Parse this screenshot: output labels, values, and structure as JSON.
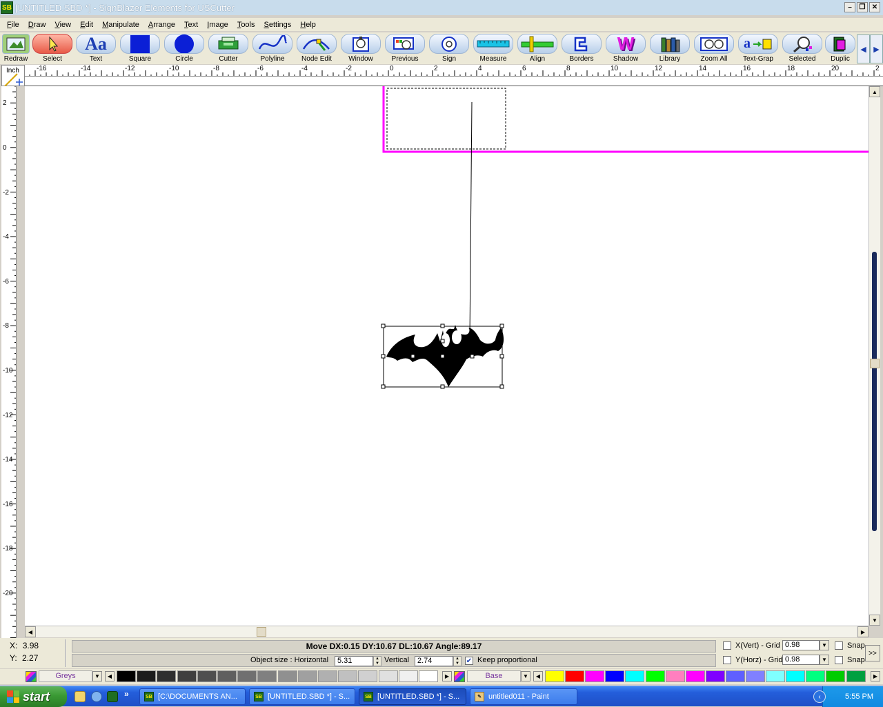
{
  "window": {
    "title": "[UNTITLED.SBD *] - SignBlazer Elements for USCutter",
    "app_icon": "SB"
  },
  "menu": [
    "File",
    "Draw",
    "View",
    "Edit",
    "Manipulate",
    "Arrange",
    "Text",
    "Image",
    "Tools",
    "Settings",
    "Help"
  ],
  "toolbar": {
    "tools": [
      {
        "label": "Redraw",
        "icon": "redraw-icon"
      },
      {
        "label": "Select",
        "icon": "arrow-cursor-icon",
        "active": true
      },
      {
        "label": "Text",
        "icon": "text-icon"
      },
      {
        "label": "Square",
        "icon": "square-icon"
      },
      {
        "label": "Circle",
        "icon": "circle-icon"
      },
      {
        "label": "Cutter",
        "icon": "cutter-icon"
      },
      {
        "label": "Polyline",
        "icon": "polyline-icon"
      },
      {
        "label": "Node Edit",
        "icon": "node-edit-icon"
      },
      {
        "label": "Window",
        "icon": "window-icon"
      },
      {
        "label": "Previous",
        "icon": "previous-icon"
      },
      {
        "label": "Sign",
        "icon": "sign-icon"
      },
      {
        "label": "Measure",
        "icon": "measure-icon"
      },
      {
        "label": "Align",
        "icon": "align-icon"
      },
      {
        "label": "Borders",
        "icon": "borders-icon"
      },
      {
        "label": "Shadow",
        "icon": "shadow-icon"
      },
      {
        "label": "Library",
        "icon": "library-icon"
      },
      {
        "label": "Zoom All",
        "icon": "zoom-all-icon"
      },
      {
        "label": "Text-Grap",
        "icon": "text-graphic-icon"
      },
      {
        "label": "Selected",
        "icon": "zoom-selected-icon"
      },
      {
        "label": "Duplic",
        "icon": "duplicate-icon"
      }
    ]
  },
  "ruler": {
    "unit": "Inch",
    "h_ticks": [
      "-16",
      "-14",
      "-12",
      "-10",
      "-8",
      "-6",
      "-4",
      "-2",
      "0",
      "2",
      "4",
      "6",
      "8",
      "10",
      "12",
      "14",
      "16",
      "18",
      "20",
      "2"
    ],
    "v_ticks": [
      "2",
      "0",
      "-2",
      "-4",
      "-6",
      "-8",
      "-10",
      "-12",
      "-14",
      "-16",
      "-18",
      "-20"
    ]
  },
  "status": {
    "x_label": "X:",
    "x_value": "3.98",
    "y_label": "Y:",
    "y_value": "2.27",
    "move_info": "Move DX:0.15 DY:10.67 DL:10.67 Angle:89.17",
    "object_size_label": "Object size : Horizontal",
    "horizontal_value": "5.31",
    "vertical_label": "Vertical",
    "vertical_value": "2.74",
    "keep_proportional_label": "Keep proportional",
    "keep_proportional": true,
    "xgrid_label": "X(Vert) - Grid",
    "xgrid_value": "0.98",
    "ygrid_label": "Y(Horz) - Grid",
    "ygrid_value": "0.98",
    "snap_label_1": "Snap",
    "snap_label_2": "Snap",
    "more_label": ">>"
  },
  "palette": {
    "grey_set_name": "Greys",
    "color_set_name": "Base",
    "greys": [
      "#000000",
      "#1c1c1c",
      "#2f2f2f",
      "#3f3f3f",
      "#4f4f4f",
      "#5f5f5f",
      "#707070",
      "#808080",
      "#909090",
      "#a0a0a0",
      "#b0b0b0",
      "#c0c0c0",
      "#d0d0d0",
      "#e0e0e0",
      "#f0f0f0",
      "#ffffff"
    ],
    "colors": [
      "#ffff00",
      "#ff0000",
      "#ff00ff",
      "#0000ff",
      "#00ffff",
      "#00ff00",
      "#ff7fbf",
      "#ff00ff",
      "#7f00ff",
      "#5f5fff",
      "#8080ff",
      "#7fffff",
      "#00ffff",
      "#00ff80",
      "#00cc00",
      "#00a040"
    ]
  },
  "taskbar": {
    "start_label": "start",
    "tasks": [
      {
        "label": "[C:\\DOCUMENTS AN...",
        "active": false
      },
      {
        "label": "[UNTITLED.SBD *] - S...",
        "active": false
      },
      {
        "label": "[UNTITLED.SBD *] - S...",
        "active": true
      },
      {
        "label": "untitled011 - Paint",
        "active": false
      }
    ],
    "clock": "5:55 PM"
  },
  "canvas": {
    "selection_color": "#ff00ff"
  }
}
